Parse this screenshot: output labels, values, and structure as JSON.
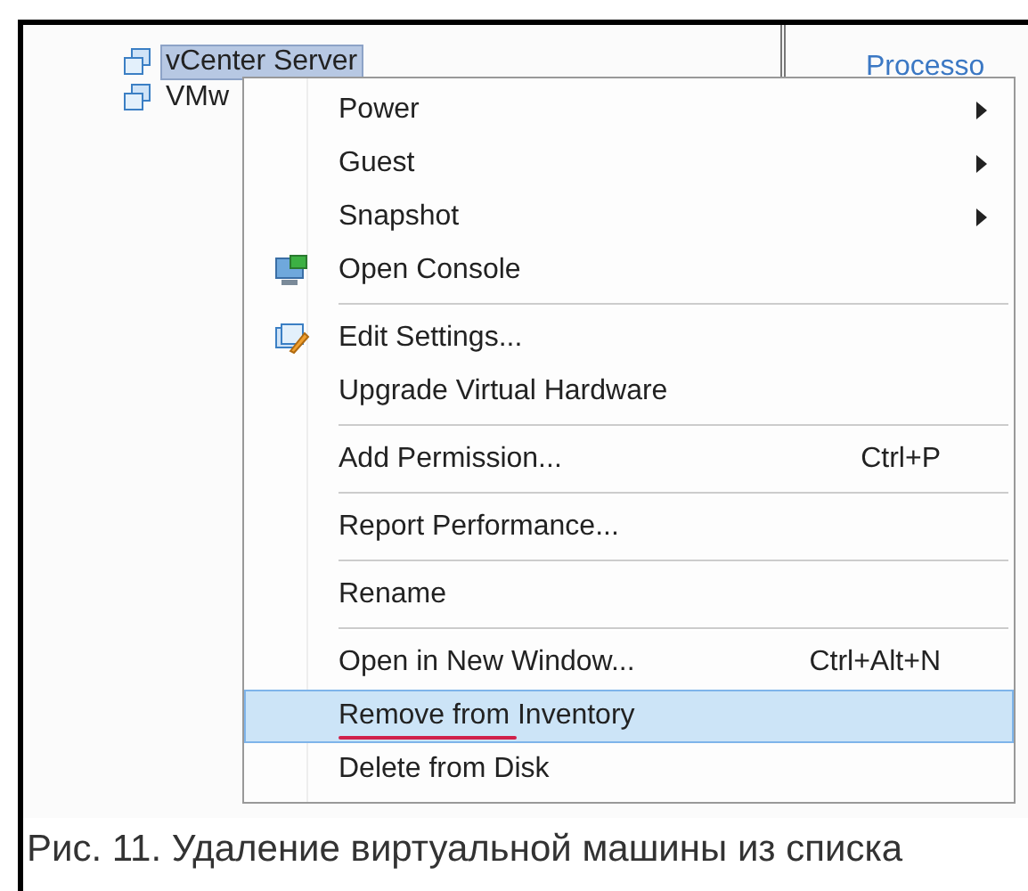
{
  "tree": {
    "items": [
      {
        "label": "vCenter Server",
        "selected": true
      },
      {
        "label": "VMw",
        "selected": false
      }
    ]
  },
  "side_panel": {
    "link": "Processo"
  },
  "context_menu": {
    "items": [
      {
        "kind": "submenu",
        "label": "Power",
        "selected": false,
        "separator_before": false
      },
      {
        "kind": "submenu",
        "label": "Guest",
        "selected": false,
        "separator_before": false
      },
      {
        "kind": "submenu",
        "label": "Snapshot",
        "selected": false,
        "separator_before": false
      },
      {
        "kind": "console",
        "label": "Open Console",
        "selected": false,
        "separator_before": false
      },
      {
        "kind": "edit",
        "label": "Edit Settings...",
        "selected": false,
        "separator_before": true
      },
      {
        "kind": "plain",
        "label": "Upgrade Virtual Hardware",
        "selected": false,
        "separator_before": false
      },
      {
        "kind": "plain",
        "label": "Add Permission...",
        "shortcut": "Ctrl+P",
        "selected": false,
        "separator_before": true
      },
      {
        "kind": "plain",
        "label": "Report Performance...",
        "selected": false,
        "separator_before": true
      },
      {
        "kind": "plain",
        "label": "Rename",
        "selected": false,
        "separator_before": true
      },
      {
        "kind": "plain",
        "label": "Open in New Window...",
        "shortcut": "Ctrl+Alt+N",
        "selected": false,
        "separator_before": true
      },
      {
        "kind": "plain",
        "label": "Remove from Inventory",
        "selected": true,
        "underlined": true,
        "separator_before": false
      },
      {
        "kind": "plain",
        "label": "Delete from Disk",
        "selected": false,
        "separator_before": false
      }
    ]
  },
  "caption": "Рис. 11. Удаление виртуальной машины из списка"
}
